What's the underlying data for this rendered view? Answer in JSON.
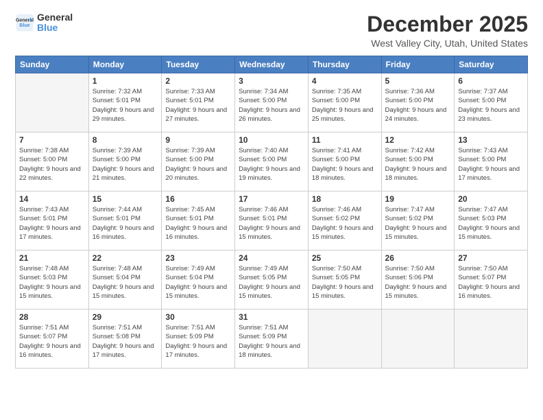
{
  "logo": {
    "line1": "General",
    "line2": "Blue"
  },
  "title": "December 2025",
  "location": "West Valley City, Utah, United States",
  "days_header": [
    "Sunday",
    "Monday",
    "Tuesday",
    "Wednesday",
    "Thursday",
    "Friday",
    "Saturday"
  ],
  "weeks": [
    [
      {
        "num": "",
        "empty": true
      },
      {
        "num": "1",
        "rise": "7:32 AM",
        "set": "5:01 PM",
        "daylight": "9 hours and 29 minutes."
      },
      {
        "num": "2",
        "rise": "7:33 AM",
        "set": "5:01 PM",
        "daylight": "9 hours and 27 minutes."
      },
      {
        "num": "3",
        "rise": "7:34 AM",
        "set": "5:00 PM",
        "daylight": "9 hours and 26 minutes."
      },
      {
        "num": "4",
        "rise": "7:35 AM",
        "set": "5:00 PM",
        "daylight": "9 hours and 25 minutes."
      },
      {
        "num": "5",
        "rise": "7:36 AM",
        "set": "5:00 PM",
        "daylight": "9 hours and 24 minutes."
      },
      {
        "num": "6",
        "rise": "7:37 AM",
        "set": "5:00 PM",
        "daylight": "9 hours and 23 minutes."
      }
    ],
    [
      {
        "num": "7",
        "rise": "7:38 AM",
        "set": "5:00 PM",
        "daylight": "9 hours and 22 minutes."
      },
      {
        "num": "8",
        "rise": "7:39 AM",
        "set": "5:00 PM",
        "daylight": "9 hours and 21 minutes."
      },
      {
        "num": "9",
        "rise": "7:39 AM",
        "set": "5:00 PM",
        "daylight": "9 hours and 20 minutes."
      },
      {
        "num": "10",
        "rise": "7:40 AM",
        "set": "5:00 PM",
        "daylight": "9 hours and 19 minutes."
      },
      {
        "num": "11",
        "rise": "7:41 AM",
        "set": "5:00 PM",
        "daylight": "9 hours and 18 minutes."
      },
      {
        "num": "12",
        "rise": "7:42 AM",
        "set": "5:00 PM",
        "daylight": "9 hours and 18 minutes."
      },
      {
        "num": "13",
        "rise": "7:43 AM",
        "set": "5:00 PM",
        "daylight": "9 hours and 17 minutes."
      }
    ],
    [
      {
        "num": "14",
        "rise": "7:43 AM",
        "set": "5:01 PM",
        "daylight": "9 hours and 17 minutes."
      },
      {
        "num": "15",
        "rise": "7:44 AM",
        "set": "5:01 PM",
        "daylight": "9 hours and 16 minutes."
      },
      {
        "num": "16",
        "rise": "7:45 AM",
        "set": "5:01 PM",
        "daylight": "9 hours and 16 minutes."
      },
      {
        "num": "17",
        "rise": "7:46 AM",
        "set": "5:01 PM",
        "daylight": "9 hours and 15 minutes."
      },
      {
        "num": "18",
        "rise": "7:46 AM",
        "set": "5:02 PM",
        "daylight": "9 hours and 15 minutes."
      },
      {
        "num": "19",
        "rise": "7:47 AM",
        "set": "5:02 PM",
        "daylight": "9 hours and 15 minutes."
      },
      {
        "num": "20",
        "rise": "7:47 AM",
        "set": "5:03 PM",
        "daylight": "9 hours and 15 minutes."
      }
    ],
    [
      {
        "num": "21",
        "rise": "7:48 AM",
        "set": "5:03 PM",
        "daylight": "9 hours and 15 minutes."
      },
      {
        "num": "22",
        "rise": "7:48 AM",
        "set": "5:04 PM",
        "daylight": "9 hours and 15 minutes."
      },
      {
        "num": "23",
        "rise": "7:49 AM",
        "set": "5:04 PM",
        "daylight": "9 hours and 15 minutes."
      },
      {
        "num": "24",
        "rise": "7:49 AM",
        "set": "5:05 PM",
        "daylight": "9 hours and 15 minutes."
      },
      {
        "num": "25",
        "rise": "7:50 AM",
        "set": "5:05 PM",
        "daylight": "9 hours and 15 minutes."
      },
      {
        "num": "26",
        "rise": "7:50 AM",
        "set": "5:06 PM",
        "daylight": "9 hours and 15 minutes."
      },
      {
        "num": "27",
        "rise": "7:50 AM",
        "set": "5:07 PM",
        "daylight": "9 hours and 16 minutes."
      }
    ],
    [
      {
        "num": "28",
        "rise": "7:51 AM",
        "set": "5:07 PM",
        "daylight": "9 hours and 16 minutes."
      },
      {
        "num": "29",
        "rise": "7:51 AM",
        "set": "5:08 PM",
        "daylight": "9 hours and 17 minutes."
      },
      {
        "num": "30",
        "rise": "7:51 AM",
        "set": "5:09 PM",
        "daylight": "9 hours and 17 minutes."
      },
      {
        "num": "31",
        "rise": "7:51 AM",
        "set": "5:09 PM",
        "daylight": "9 hours and 18 minutes."
      },
      {
        "num": "",
        "empty": true
      },
      {
        "num": "",
        "empty": true
      },
      {
        "num": "",
        "empty": true
      }
    ]
  ],
  "labels": {
    "sunrise": "Sunrise:",
    "sunset": "Sunset:",
    "daylight": "Daylight:"
  }
}
